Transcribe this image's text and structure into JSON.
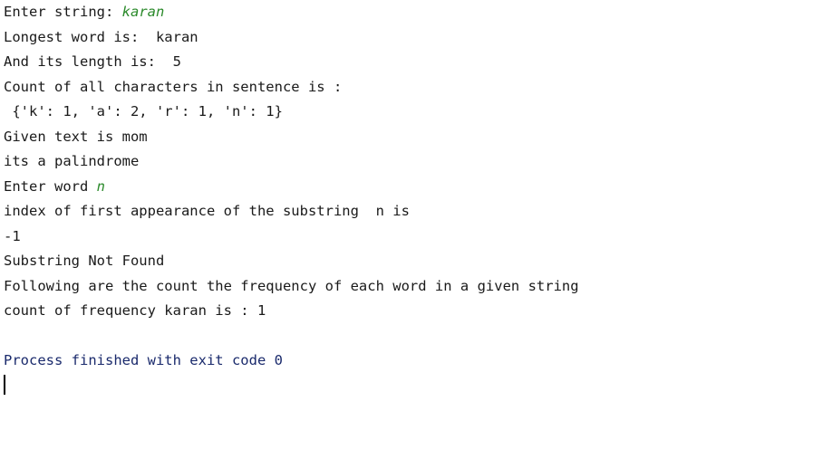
{
  "console": {
    "prompt_string": "Enter string: ",
    "input_string": "karan",
    "longest_word": "Longest word is:  karan",
    "length": "And its length is:  5",
    "count_header": "Count of all characters in sentence is :",
    "count_dict": " {'k': 1, 'a': 2, 'r': 1, 'n': 1}",
    "given_text": "Given text is mom",
    "palindrome": "its a palindrome",
    "prompt_word": "Enter word ",
    "input_word": "n",
    "index_line": "index of first appearance of the substring  n is",
    "index_value": "-1",
    "not_found": "Substring Not Found",
    "freq_header": "Following are the count the frequency of each word in a given string",
    "freq_line": "count of frequency karan is : 1",
    "exit_message": "Process finished with exit code 0"
  },
  "colors": {
    "input": "#2b8a2b",
    "exit": "#1a2a6c",
    "text": "#1a1a1a"
  }
}
